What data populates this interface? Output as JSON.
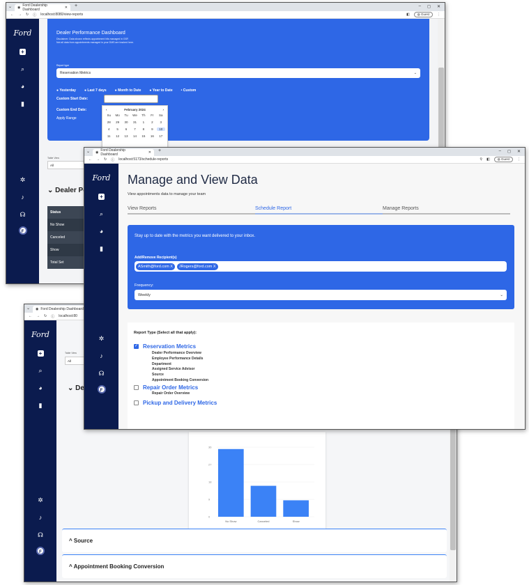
{
  "tab_title": "Ford Dealership Dashboard",
  "sidebar": {
    "logo": "Ford",
    "avatar_letter": "F"
  },
  "win1": {
    "url": "localhost:8080/view-reports",
    "guest": "Guest",
    "title": "Dealer Performance Dashboard",
    "disclaimer1": "Disclaimer: Data shown reflects appointment hits managed in GSF.",
    "disclaimer2": "Not all data from appointments managed in your DMS are tracked here.",
    "report_type_label": "Report type",
    "report_type_value": "Reservation Metrics",
    "ranges": [
      "Yesterday",
      "Last 7 days",
      "Month to Date",
      "Year to Date",
      "Custom"
    ],
    "start_label": "Custom Start Date:",
    "end_label": "Custom End Date:",
    "apply": "Apply Range",
    "calendar": {
      "month": "February 2024",
      "days": [
        "Su",
        "Mo",
        "Tu",
        "We",
        "Th",
        "Fr",
        "Sa"
      ],
      "week1": [
        "28",
        "29",
        "30",
        "31",
        "1",
        "2",
        "3"
      ],
      "week2": [
        "4",
        "5",
        "6",
        "7",
        "8",
        "9",
        "10"
      ],
      "week3": [
        "11",
        "12",
        "13",
        "14",
        "15",
        "16",
        "17"
      ]
    },
    "table_view_label": "Table View",
    "table_view_value": "All",
    "section": "Dealer Pe",
    "table": {
      "header": "Status",
      "rows": [
        "No Show",
        "Canceled",
        "Show",
        "Total Set"
      ]
    }
  },
  "win2": {
    "url": "localhost:5173/schedule-reports",
    "guest": "Guest",
    "heading": "Manage and View Data",
    "subheading": "View appointments data to manage your team",
    "tabs": [
      "View Reports",
      "Schedule Report",
      "Manage Reports"
    ],
    "banner_text": "Stay up to date with the metrics you want delivered to your inbox.",
    "recipients_label": "Add/Remove Recipient(s)",
    "recipients": [
      "ASmith@ford.com X",
      "JRogers@ford.com X"
    ],
    "frequency_label": "Frequency:",
    "frequency_value": "Weekly",
    "report_type_label": "Report Type (Select all that apply):",
    "groups": [
      {
        "title": "Reservation Metrics",
        "checked": true,
        "items": [
          "Dealer Performance Overview",
          "Employee Performance Details",
          "Department",
          "Assigned Service Advisor",
          "Source",
          "Appointment Booking Conversion"
        ]
      },
      {
        "title": "Repair Order Metrics",
        "checked": false,
        "items": [
          "Repair Order Overview"
        ]
      },
      {
        "title": "Pickup and Delivery Metrics",
        "checked": false,
        "items": []
      }
    ]
  },
  "win3": {
    "url": "localhost:80",
    "table_view_label": "Table View",
    "table_view_value": "All",
    "section": "De",
    "chart_data": {
      "type": "bar",
      "categories": [
        "No Show",
        "Canceled",
        "Show"
      ],
      "values": [
        35,
        16,
        8.5
      ],
      "yticks": [
        "0",
        "9",
        "18",
        "27",
        "36"
      ],
      "ylim": [
        0,
        36
      ],
      "color": "#3b82f6"
    },
    "sections": [
      "Source",
      "Appointment Booking Conversion"
    ]
  }
}
